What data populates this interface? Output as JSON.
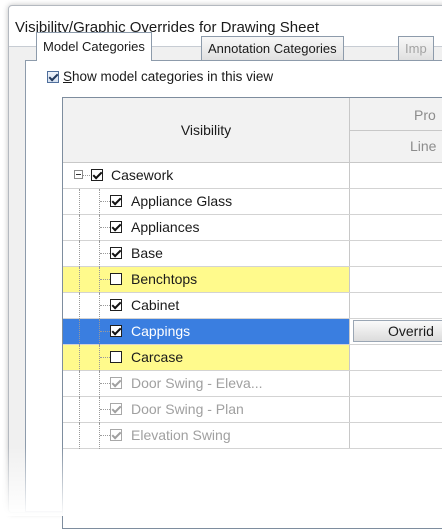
{
  "window": {
    "title": "Visibility/Graphic Overrides for Drawing Sheet"
  },
  "tabs": [
    {
      "label": "Model Categories",
      "state": "active"
    },
    {
      "label": "Annotation Categories",
      "state": "normal"
    },
    {
      "label": "Imp",
      "state": "disabled"
    }
  ],
  "show_model_categories": {
    "label_u": "S",
    "label_rest": "how model categories in this view",
    "checked": true
  },
  "grid": {
    "header_visibility": "Visibility",
    "header_projection": "Pro",
    "header_lines": "Line"
  },
  "rows": [
    {
      "label": "Casework",
      "checked": true,
      "level": 0,
      "style": "normal"
    },
    {
      "label": "Appliance Glass",
      "checked": true,
      "level": 1,
      "style": "normal"
    },
    {
      "label": "Appliances",
      "checked": true,
      "level": 1,
      "style": "normal"
    },
    {
      "label": "Base",
      "checked": true,
      "level": 1,
      "style": "normal"
    },
    {
      "label": "Benchtops",
      "checked": false,
      "level": 1,
      "style": "yellow"
    },
    {
      "label": "Cabinet",
      "checked": true,
      "level": 1,
      "style": "normal"
    },
    {
      "label": "Cappings",
      "checked": true,
      "level": 1,
      "style": "selected",
      "override_label": "Overrid"
    },
    {
      "label": "Carcase",
      "checked": false,
      "level": 1,
      "style": "yellow"
    },
    {
      "label": "Door Swing - Eleva...",
      "checked": true,
      "level": 1,
      "style": "greyed"
    },
    {
      "label": "Door Swing - Plan",
      "checked": true,
      "level": 1,
      "style": "greyed"
    },
    {
      "label": "Elevation Swing",
      "checked": true,
      "level": 1,
      "style": "greyed"
    }
  ],
  "colors": {
    "selection": "#3a7ee0",
    "highlight": "#fffa8c"
  }
}
